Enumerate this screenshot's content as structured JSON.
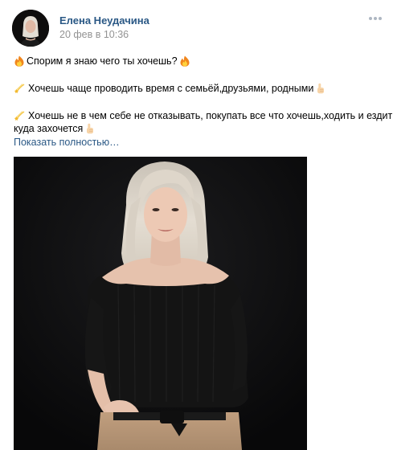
{
  "post": {
    "author_name": "Елена Неудачина",
    "date": "20 фев в 10:36",
    "text_lines": [
      "Спорим я знаю чего ты хочешь?",
      "Хочешь чаще проводить время с семьёй,друзьями, родными",
      "Хочешь не в чем себе не отказывать, покупать все что хочешь,ходить и ездить",
      "куда захочется"
    ],
    "show_more": "Показать полностью…"
  },
  "icons": {
    "fire": "fire-emoji-icon",
    "sparkle": "dizzy-emoji-icon",
    "pointing_hand": "pointing-up-hand-emoji-icon",
    "more": "more-horizontal-icon"
  },
  "colors": {
    "link": "#2a5885",
    "meta": "#939393",
    "more_dots": "#aeb7c2",
    "photo_background": "#0d0d0e"
  }
}
